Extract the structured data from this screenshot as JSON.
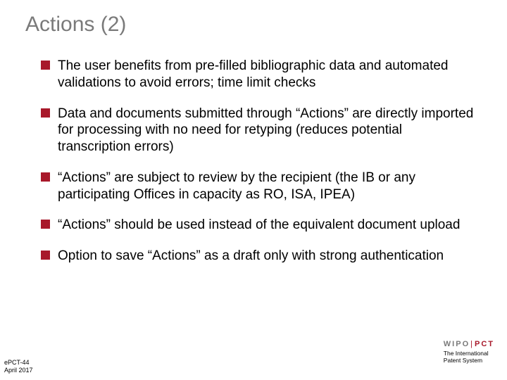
{
  "title": "Actions (2)",
  "bullets": [
    "The user benefits from pre-filled bibliographic data and automated validations to avoid errors; time limit checks",
    "Data and documents submitted through “Actions” are directly imported for processing with no need for retyping (reduces potential transcription errors)",
    "“Actions” are subject to review by the recipient (the IB or any participating Offices in capacity as RO, ISA, IPEA)",
    "“Actions” should be used instead of the equivalent document upload",
    "Option to save “Actions” as a draft only with strong authentication"
  ],
  "footer": {
    "ref": "ePCT-44",
    "date": "April 2017"
  },
  "brand": {
    "wipo": "WIPO",
    "bar": "|",
    "pct": "PCT",
    "tagline1": "The International",
    "tagline2": "Patent System"
  }
}
